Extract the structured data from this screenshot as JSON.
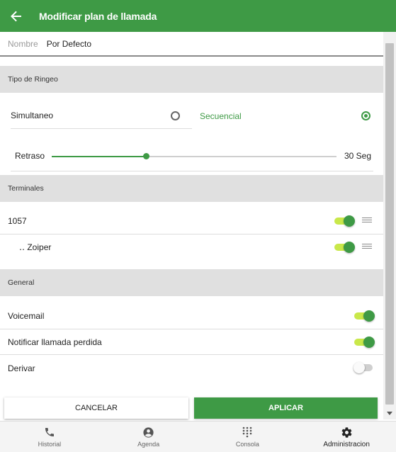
{
  "appbar": {
    "title": "Modificar plan de llamada",
    "back_icon": "arrow-left-icon"
  },
  "name_field": {
    "label": "Nombre",
    "value": "Por Defecto"
  },
  "ring_type": {
    "header": "Tipo de Ringeo",
    "options": [
      {
        "label": "Simultaneo",
        "selected": false
      },
      {
        "label": "Secuencial",
        "selected": true
      }
    ],
    "delay": {
      "label": "Retraso",
      "value_text": "30 Seg",
      "level_fraction": 0.33
    }
  },
  "terminals": {
    "header": "Terminales",
    "items": [
      {
        "label": "1057",
        "enabled": true
      },
      {
        "label": "‥ Zoiper",
        "enabled": true
      }
    ]
  },
  "general": {
    "header": "General",
    "items": [
      {
        "label": "Voicemail",
        "enabled": true
      },
      {
        "label": "Notificar llamada perdida",
        "enabled": true
      },
      {
        "label": "Derivar",
        "enabled": false
      }
    ]
  },
  "actions": {
    "cancel_label": "CANCELAR",
    "apply_label": "APLICAR"
  },
  "bottom_nav": {
    "items": [
      {
        "label": "Historial",
        "icon": "phone-icon",
        "active": false
      },
      {
        "label": "Agenda",
        "icon": "account-icon",
        "active": false
      },
      {
        "label": "Consola",
        "icon": "dialpad-icon",
        "active": false
      },
      {
        "label": "Administracion",
        "icon": "gear-icon",
        "active": true
      }
    ]
  },
  "colors": {
    "primary": "#3e9a45",
    "toggle_track_on": "#c9e84a",
    "section_bg": "#e0e0e0"
  }
}
